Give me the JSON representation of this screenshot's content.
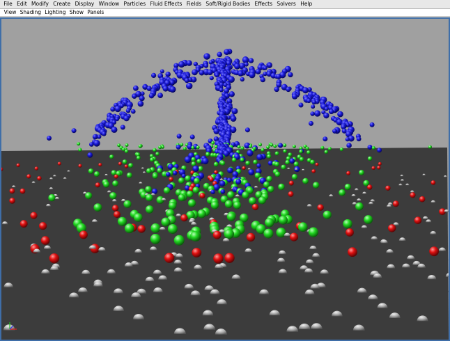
{
  "main_menu": [
    {
      "id": "file",
      "label": "File"
    },
    {
      "id": "edit",
      "label": "Edit"
    },
    {
      "id": "modify",
      "label": "Modify"
    },
    {
      "id": "create",
      "label": "Create"
    },
    {
      "id": "display",
      "label": "Display"
    },
    {
      "id": "window",
      "label": "Window"
    },
    {
      "id": "particles",
      "label": "Particles"
    },
    {
      "id": "fluid-effects",
      "label": "Fluid Effects"
    },
    {
      "id": "fields",
      "label": "Fields"
    },
    {
      "id": "soft-rigid-bodies",
      "label": "Soft/Rigid Bodies"
    },
    {
      "id": "effects",
      "label": "Effects"
    },
    {
      "id": "solvers",
      "label": "Solvers"
    },
    {
      "id": "help",
      "label": "Help"
    }
  ],
  "panel_menu": [
    {
      "id": "view",
      "label": "View"
    },
    {
      "id": "shading",
      "label": "Shading"
    },
    {
      "id": "lighting",
      "label": "Lighting"
    },
    {
      "id": "show",
      "label": "Show"
    },
    {
      "id": "panels",
      "label": "Panels"
    }
  ],
  "viewport": {
    "background_color": "#a0a0a0",
    "ground_color": "#3c3c3c",
    "particle_colors": {
      "blue": "#1515d0",
      "green": "#20d020",
      "red": "#e01010",
      "gray": "#b4b4b4"
    },
    "axis_icon": "xyz-axis-icon"
  }
}
